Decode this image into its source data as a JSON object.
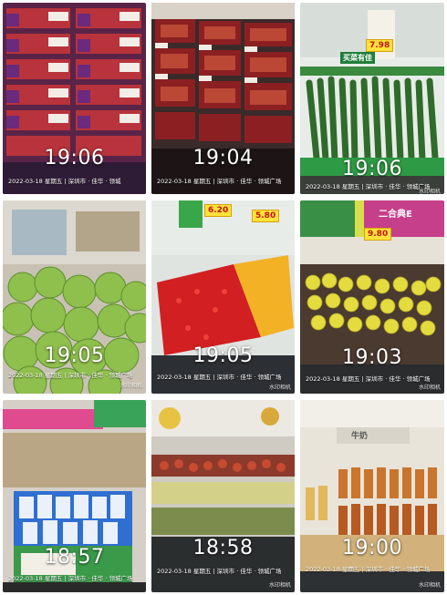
{
  "tiles": [
    {
      "time": "19:06",
      "stamp": "2022-03-18 星期五 | 深圳市 · 佳华 · 领城",
      "brand": ""
    },
    {
      "time": "19:04",
      "stamp": "2022-03-18 星期五 | 深圳市 · 佳华 · 领城广场",
      "brand": ""
    },
    {
      "time": "19:06",
      "stamp": "2022-03-18 星期五 | 深圳市 · 佳华 · 领城广场",
      "brand": "水印相机",
      "price": "7.98",
      "sign": "买菜有佳"
    },
    {
      "time": "19:05",
      "stamp": "2022-03-18 星期五 | 深圳市 · 佳华 · 领城广场",
      "brand": "水印相机"
    },
    {
      "time": "19:05",
      "stamp": "2022-03-18 星期五 | 深圳市 · 佳华 · 领城广场",
      "brand": "水印相机",
      "price": "6.20",
      "price2": "5.80"
    },
    {
      "time": "19:03",
      "stamp": "2022-03-18 星期五 | 深圳市 · 佳华 · 领城广场",
      "brand": "水印相机",
      "sign": "二合典E",
      "price": "9.80"
    },
    {
      "time": "18:57",
      "stamp": "2022-03-18 星期五 | 深圳市 · 佳华 · 领城广场",
      "brand": ""
    },
    {
      "time": "18:58",
      "stamp": "2022-03-18 星期五 | 深圳市 · 佳华 · 领城广场",
      "brand": "水印相机"
    },
    {
      "time": "19:00",
      "stamp": "2022-03-18 星期五 | 深圳市 · 佳华 · 领城广场",
      "brand": "水印相机",
      "sign": "牛奶"
    }
  ]
}
